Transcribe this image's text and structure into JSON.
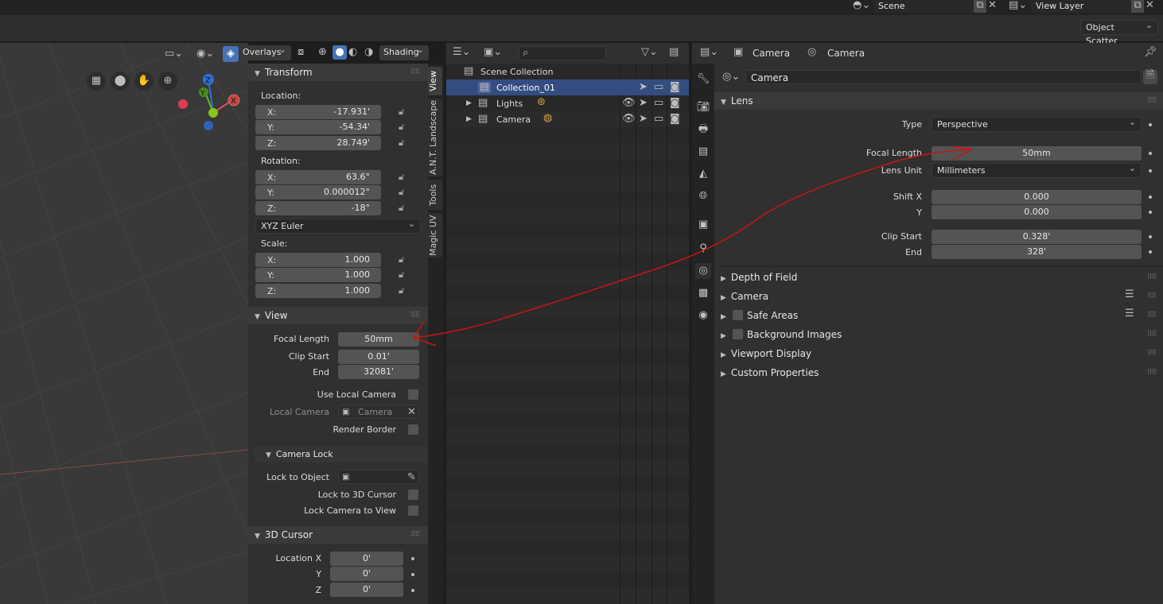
{
  "topbar": {
    "scene": "Scene",
    "view_layer": "View Layer",
    "object_scatter": "Object Scatter"
  },
  "viewport": {
    "overlays": "Overlays",
    "shading": "Shading",
    "gizmo": {
      "z": "Z",
      "y": "Y",
      "x": "X"
    }
  },
  "npanel": {
    "tabs": [
      "View",
      "A.N.T. Landscape",
      "Tools",
      "Magic UV"
    ],
    "transform": {
      "title": "Transform",
      "location_label": "Location:",
      "location": {
        "x": "-17.931'",
        "y": "-54.34'",
        "z": "28.749'"
      },
      "rotation_label": "Rotation:",
      "rotation": {
        "x": "63.6°",
        "y": "0.000012°",
        "z": "-18°"
      },
      "rotation_mode": "XYZ Euler",
      "scale_label": "Scale:",
      "scale": {
        "x": "1.000",
        "y": "1.000",
        "z": "1.000"
      },
      "axis": {
        "x": "X:",
        "y": "Y:",
        "z": "Z:"
      }
    },
    "view": {
      "title": "View",
      "focal_length_label": "Focal Length",
      "focal_length": "50mm",
      "clip_start_label": "Clip Start",
      "clip_start": "0.01'",
      "end_label": "End",
      "end": "32081'",
      "use_local_camera": "Use Local Camera",
      "local_camera_label": "Local Camera",
      "local_camera": "Camera",
      "render_border": "Render Border"
    },
    "camera_lock": {
      "title": "Camera Lock",
      "lock_to_object": "Lock to Object",
      "lock_to_3d_cursor": "Lock to 3D Cursor",
      "lock_camera_to_view": "Lock Camera to View"
    },
    "cursor": {
      "title": "3D Cursor",
      "location_x_label": "Location X",
      "y_label": "Y",
      "z_label": "Z",
      "x": "0'",
      "y": "0'",
      "z": "0'"
    }
  },
  "outliner": {
    "items": [
      {
        "label": "Scene Collection"
      },
      {
        "label": "Collection_01"
      },
      {
        "label": "Lights"
      },
      {
        "label": "Camera"
      }
    ]
  },
  "properties": {
    "breadcrumb": {
      "object": "Camera",
      "data": "Camera"
    },
    "datablock": "Camera",
    "lens": {
      "title": "Lens",
      "type_label": "Type",
      "type": "Perspective",
      "focal_length_label": "Focal Length",
      "focal_length": "50mm",
      "lens_unit_label": "Lens Unit",
      "lens_unit": "Millimeters",
      "shift_x_label": "Shift X",
      "shift_x": "0.000",
      "y_label": "Y",
      "shift_y": "0.000",
      "clip_start_label": "Clip Start",
      "clip_start": "0.328'",
      "end_label": "End",
      "clip_end": "328'"
    },
    "sections": {
      "dof": "Depth of Field",
      "camera": "Camera",
      "safe_areas": "Safe Areas",
      "background_images": "Background Images",
      "viewport_display": "Viewport Display",
      "custom_properties": "Custom Properties"
    }
  },
  "colors": {
    "accent": "#4772b3",
    "annotation": "#c81414",
    "selected_row": "#334d80"
  }
}
